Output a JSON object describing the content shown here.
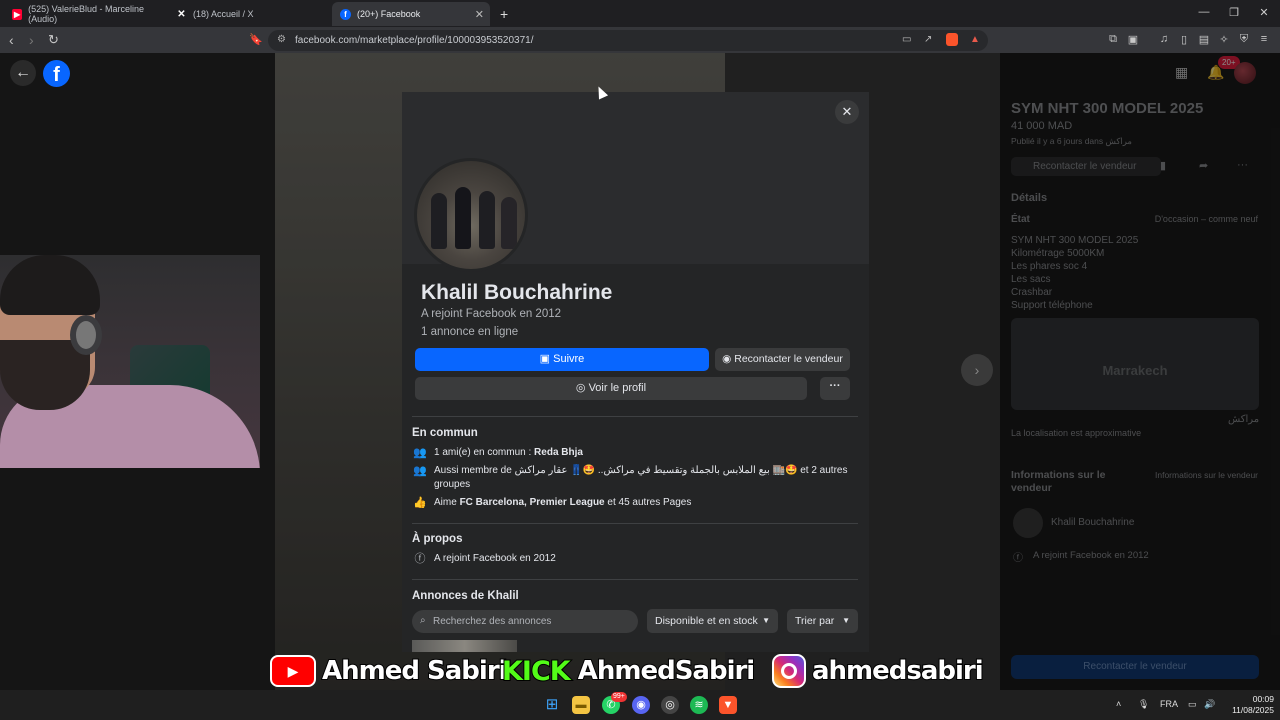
{
  "browser": {
    "tabs": [
      {
        "title": "(525) ValerieBlud - Marceline (Audio)",
        "favicon": "youtube-icon",
        "color": "#ff0033"
      },
      {
        "title": "(18) Accueil / X",
        "favicon": "x-icon",
        "color": "#000000"
      },
      {
        "title": "(20+) Facebook",
        "favicon": "facebook-icon",
        "color": "#0866ff"
      }
    ],
    "new_tab": "+",
    "url": "facebook.com/marketplace/profile/100003953520371/"
  },
  "facebook": {
    "notifications_badge": "20+",
    "accent": "#0866ff"
  },
  "listing": {
    "title": "SYM NHT 300 MODEL 2025",
    "price": "41 000 MAD",
    "posted": "Publié il y a 6 jours dans مراكش",
    "contact_seller": "Recontacter le vendeur",
    "details_title": "Détails",
    "state_label": "État",
    "state_value": "D'occasion – comme neuf",
    "description_lines": [
      "SYM NHT 300 MODEL 2025",
      "Kilométrage 5000KM",
      "Les phares soc 4",
      "Les sacs",
      "Crashbar",
      "Support téléphone"
    ],
    "map_label": "Marrakech",
    "city": "مراكش",
    "location_note": "La localisation est approximative",
    "seller_info_title": "Informations sur le vendeur",
    "seller_details_link": "Informations sur le vendeur",
    "seller_name": "Khalil Bouchahrine",
    "seller_joined": "A rejoint Facebook en 2012",
    "bottom_button": "Recontacter le vendeur"
  },
  "modal": {
    "name": "Khalil Bouchahrine",
    "joined": "A rejoint Facebook en 2012",
    "listings_count": "1 annonce en ligne",
    "follow_label": "Suivre",
    "contact_label": "Recontacter le vendeur",
    "view_profile_label": "Voir le profil",
    "more_label": "···",
    "common": {
      "title": "En commun",
      "friends_prefix": "1 ami(e) en commun : ",
      "friend_name": "Reda Bhja",
      "groups_prefix": "Aussi membre de ",
      "groups_text": "بيع الملابس بالجملة وتقسيط في مراكش.. 🤩👖 عقار مراكش 🏬🤩",
      "groups_suffix": " et 2 autres groupes",
      "likes_prefix": "Aime ",
      "likes_names": "FC Barcelona, Premier League",
      "likes_suffix": " et 45 autres Pages"
    },
    "about": {
      "title": "À propos",
      "joined": "A rejoint Facebook en 2012"
    },
    "listings": {
      "title": "Annonces de Khalil",
      "search_placeholder": "Recherchez des annonces",
      "filter_label": "Disponible et en stock",
      "sort_label": "Trier par"
    }
  },
  "overlay": {
    "youtube_name": "Ahmed Sabiri",
    "kick_logo": "KICK",
    "kick_name": "AhmedSabiri",
    "instagram_name": "ahmedsabiri"
  },
  "taskbar": {
    "whatsapp_badge": "99+",
    "language": "FRA",
    "time": "00:09",
    "date": "11/08/2025"
  }
}
